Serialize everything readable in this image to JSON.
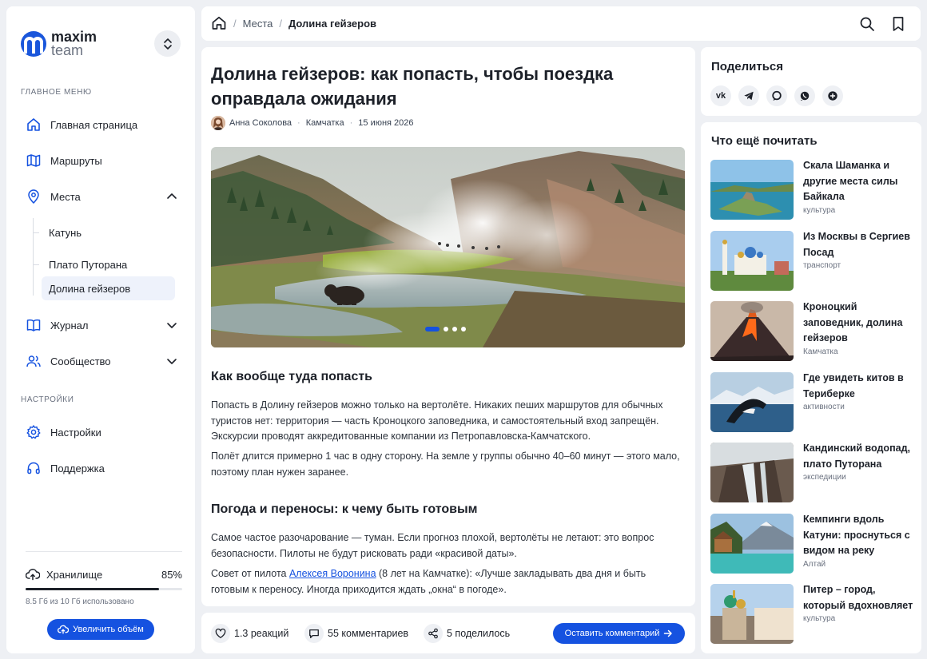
{
  "logo": {
    "line1": "maxim",
    "line2": "team"
  },
  "sidebar": {
    "main_menu_label": "ГЛАВНОЕ МЕНЮ",
    "settings_label": "НАСТРОЙКИ",
    "items": {
      "home": "Главная страница",
      "routes": "Маршруты",
      "places": "Места",
      "journal": "Журнал",
      "community": "Сообщество",
      "settings": "Настройки",
      "support": "Поддержка"
    },
    "places_sub": [
      "Катунь",
      "Плато Путорана",
      "Долина гейзеров"
    ],
    "storage": {
      "label": "Хранилище",
      "percent_text": "85%",
      "fill": 0.85,
      "used_text": "8.5 Гб из 10 Гб использовано",
      "upgrade_label": "Увеличить объём"
    }
  },
  "breadcrumb": {
    "section": "Места",
    "current": "Долина гейзеров"
  },
  "article": {
    "title": "Долина гейзеров: как попасть, чтобы поездка оправдала ожидания",
    "author": "Анна Соколова",
    "region": "Камчатка",
    "date": "15 июня 2026",
    "slides": {
      "total": 4,
      "active": 1
    },
    "section1_heading": "Как вообще туда попасть",
    "p1": "Попасть в Долину гейзеров можно только на вертолёте. Никаких пеших маршрутов для обычных туристов нет: территория — часть Кроноцкого заповедника, и самостоятельный вход запрещён. Экскурсии проводят аккредитованные компании из Петропавловска-Камчатского.",
    "p2": "Полёт длится примерно 1 час в одну сторону. На земле у группы обычно 40–60 минут — этого мало, поэтому план нужен заранее.",
    "section2_heading": "Погода и переносы: к чему быть готовым",
    "p3": "Самое частое разочарование — туман. Если прогноз плохой, вертолёты не летают: это вопрос безопасности. Пилоты не будут рисковать ради «красивой даты».",
    "p4_before": "Совет от пилота ",
    "p4_link": "Алексея Воронина",
    "p4_after": " (8 лет на Камчатке): «Лучше закладывать два дня и быть готовым к переносу. Иногда приходится ждать „окна“ в погоде»."
  },
  "footer": {
    "reactions": "1.3 реакций",
    "comments": "55 комментариев",
    "shares": "5 поделилось",
    "comment_button": "Оставить комментарий"
  },
  "share": {
    "title": "Поделиться",
    "networks": [
      "vk-icon",
      "telegram-icon",
      "chat-icon",
      "whatsapp-icon",
      "plus-icon"
    ],
    "vk_text": "vk"
  },
  "related": {
    "title": "Что ещё почитать",
    "items": [
      {
        "title": "Скала Шаманка и другие места силы Байкала",
        "category": "культура"
      },
      {
        "title": "Из Москвы в Сергиев Посад",
        "category": "транспорт"
      },
      {
        "title": "Кроноцкий заповедник, долина гейзеров",
        "category": "Камчатка"
      },
      {
        "title": "Где увидеть китов в Териберке",
        "category": "активности"
      },
      {
        "title": "Кандинский водопад, плато Путорана",
        "category": "экспедиции"
      },
      {
        "title": "Кемпинги вдоль Катуни: проснуться с видом на реку",
        "category": "Алтай"
      },
      {
        "title": "Питер – город, который вдохновляет",
        "category": "культура"
      }
    ]
  },
  "colors": {
    "accent": "#1552e0",
    "text": "#1d2129",
    "muted": "#6b7280",
    "background": "#eef0f4"
  }
}
